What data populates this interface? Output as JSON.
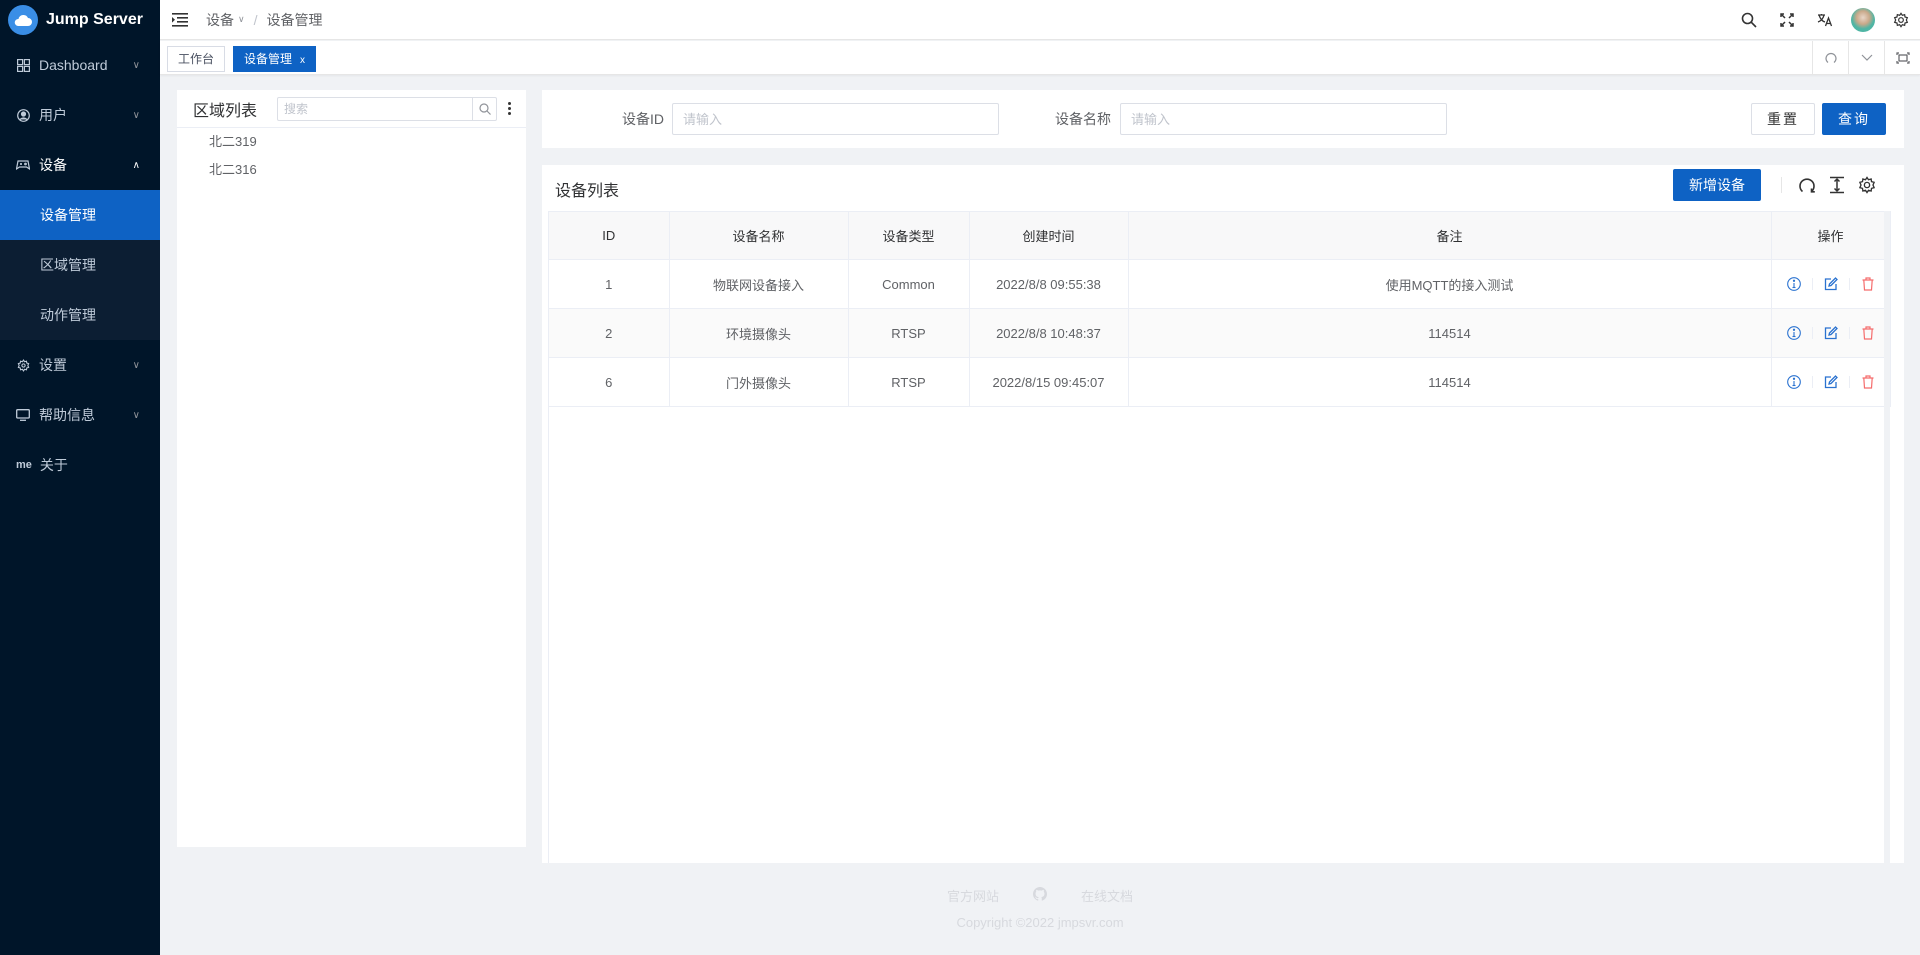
{
  "app": {
    "title": "Jump Server"
  },
  "sidebar": {
    "items": [
      {
        "label": "Dashboard",
        "icon": "dashboard-icon",
        "expanded": false
      },
      {
        "label": "用户",
        "icon": "user-icon",
        "expanded": false
      },
      {
        "label": "设备",
        "icon": "gamepad-icon",
        "expanded": true,
        "children": [
          {
            "label": "设备管理",
            "active": true
          },
          {
            "label": "区域管理",
            "active": false
          },
          {
            "label": "动作管理",
            "active": false
          }
        ]
      },
      {
        "label": "设置",
        "icon": "gear-icon",
        "expanded": false
      },
      {
        "label": "帮助信息",
        "icon": "monitor-icon",
        "expanded": false
      },
      {
        "label": "关于",
        "icon": "me-icon",
        "icon_text": "me"
      }
    ]
  },
  "header": {
    "breadcrumb": [
      {
        "label": "设备"
      },
      {
        "label": "设备管理"
      }
    ],
    "separator": "/"
  },
  "tags": [
    {
      "label": "工作台",
      "active": false
    },
    {
      "label": "设备管理",
      "active": true,
      "close": "x"
    }
  ],
  "tree": {
    "title": "区域列表",
    "search_placeholder": "搜索",
    "nodes": [
      {
        "label": "北二319"
      },
      {
        "label": "北二316"
      }
    ]
  },
  "filter": {
    "fields": [
      {
        "label": "设备ID",
        "placeholder": "请输入",
        "value": ""
      },
      {
        "label": "设备名称",
        "placeholder": "请输入",
        "value": ""
      }
    ],
    "reset_label": "重置",
    "query_label": "查询"
  },
  "device_list": {
    "title": "设备列表",
    "add_label": "新增设备",
    "columns": [
      "ID",
      "设备名称",
      "设备类型",
      "创建时间",
      "备注",
      "操作"
    ],
    "rows": [
      {
        "id": "1",
        "name": "物联网设备接入",
        "type": "Common",
        "created": "2022/8/8 09:55:38",
        "remark": "使用MQTT的接入测试"
      },
      {
        "id": "2",
        "name": "环境摄像头",
        "type": "RTSP",
        "created": "2022/8/8 10:48:37",
        "remark": "114514"
      },
      {
        "id": "6",
        "name": "门外摄像头",
        "type": "RTSP",
        "created": "2022/8/15 09:45:07",
        "remark": "114514"
      }
    ]
  },
  "footer": {
    "links": [
      {
        "label": "官方网站"
      },
      {
        "label": "github-icon",
        "icon": true
      },
      {
        "label": "在线文档"
      }
    ],
    "copyright": "Copyright ©2022 jmpsvr.com"
  },
  "colors": {
    "primary": "#0e62c4",
    "sidebar_bg": "#001529",
    "danger": "#f56c6c"
  }
}
